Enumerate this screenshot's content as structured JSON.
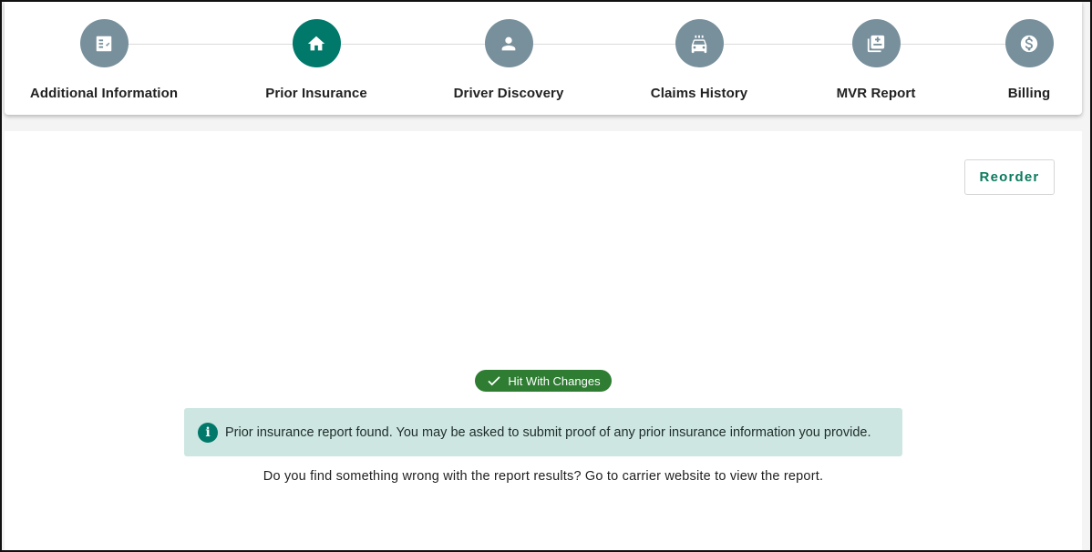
{
  "stepper": {
    "steps": [
      {
        "label": "Additional Information",
        "icon": "checklist-icon",
        "active": false
      },
      {
        "label": "Prior Insurance",
        "icon": "home-icon",
        "active": true
      },
      {
        "label": "Driver Discovery",
        "icon": "person-icon",
        "active": false
      },
      {
        "label": "Claims History",
        "icon": "car-crash-icon",
        "active": false
      },
      {
        "label": "MVR Report",
        "icon": "report-icon",
        "active": false
      },
      {
        "label": "Billing",
        "icon": "dollar-icon",
        "active": false
      }
    ]
  },
  "actions": {
    "reorder_label": "Reorder"
  },
  "status": {
    "badge_label": "Hit With Changes",
    "badge_color": "#2e7d32"
  },
  "alert": {
    "icon": "info-icon",
    "text": "Prior insurance report found. You may be asked to submit proof of any prior insurance information you provide."
  },
  "footnote": "Do you find something wrong with the report results? Go to carrier website to view the report.",
  "colors": {
    "accent": "#00796b",
    "inactive_step": "#78909c",
    "alert_bg": "#cde6e1"
  }
}
